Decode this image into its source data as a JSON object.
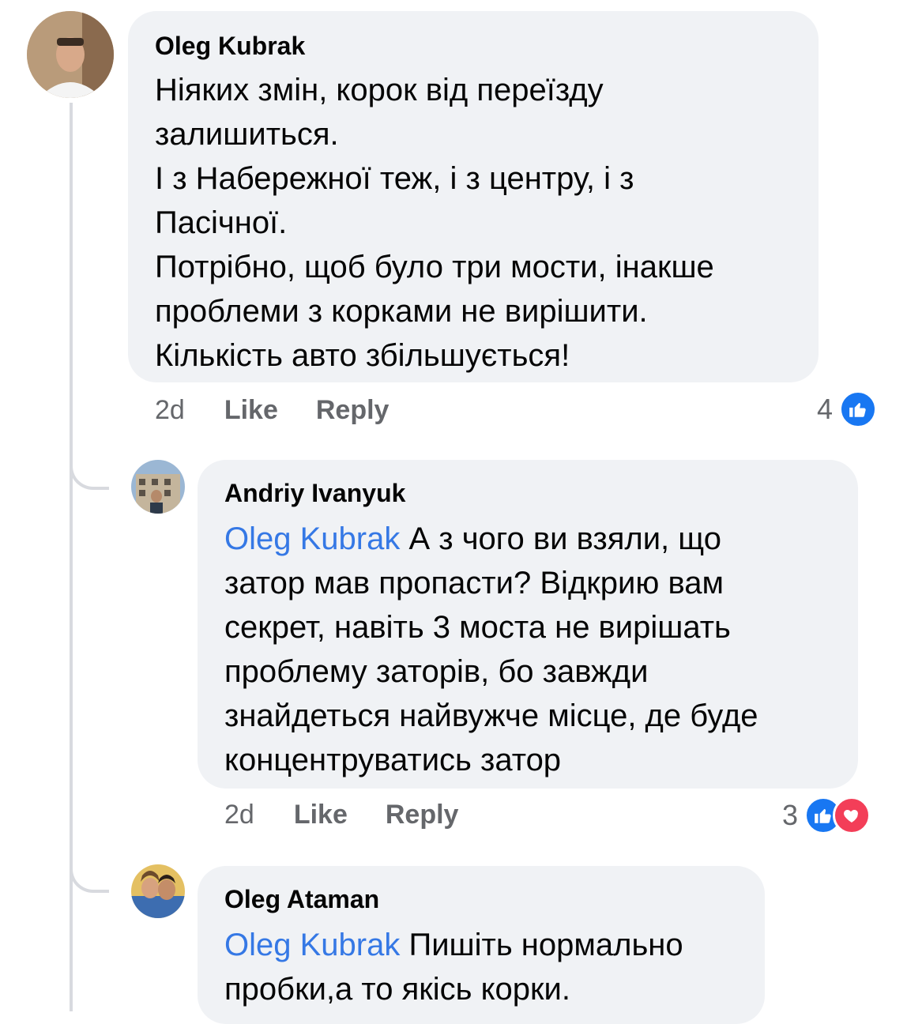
{
  "comments": [
    {
      "author": "Oleg Kubrak",
      "lines": [
        "Ніяких змін, корок від переїзду",
        "залишиться.",
        "І з Набережної теж, і з центру, і з",
        "Пасічної.",
        "Потрібно, щоб було три мости, інакше",
        "проблеми з корками не вирішити.",
        "Кількість авто збільшується!"
      ],
      "time": "2d",
      "like_label": "Like",
      "reply_label": "Reply",
      "reaction_count": "4",
      "reactions": [
        "like-icon"
      ]
    },
    {
      "author": "Andriy Ivanyuk",
      "mention": "Oleg Kubrak",
      "lines": [
        " А з чого ви взяли, що",
        "затор мав пропасти? Відкрию вам",
        "секрет, навіть 3 моста не вирішать",
        "проблему заторів, бо завжди",
        "знайдеться найвужче місце, де буде",
        "концентруватись затор"
      ],
      "time": "2d",
      "like_label": "Like",
      "reply_label": "Reply",
      "reaction_count": "3",
      "reactions": [
        "like-icon",
        "love-icon"
      ]
    },
    {
      "author": "Oleg Ataman",
      "mention": "Oleg Kubrak",
      "lines": [
        " Пишіть нормально",
        "пробки,а то якісь корки."
      ]
    }
  ],
  "colors": {
    "bubble": "#f0f2f5",
    "mention": "#3578e5",
    "like": "#1877f2",
    "love": "#f33e58",
    "meta": "#65676b"
  }
}
